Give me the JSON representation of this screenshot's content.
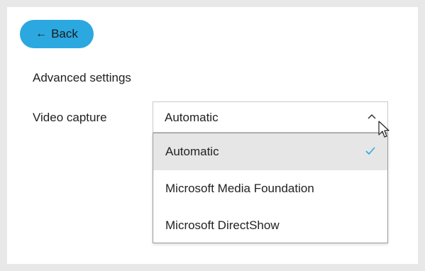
{
  "back_button": {
    "label": "Back",
    "icon": "arrow-left-icon"
  },
  "section": {
    "title": "Advanced settings"
  },
  "video_capture": {
    "label": "Video capture",
    "selected_value": "Automatic",
    "options": [
      {
        "label": "Automatic",
        "selected": true
      },
      {
        "label": "Microsoft Media Foundation",
        "selected": false
      },
      {
        "label": "Microsoft DirectShow",
        "selected": false
      }
    ]
  },
  "colors": {
    "accent": "#2ba8e0",
    "check": "#2ba8e0",
    "selected_option_bg": "#e6e6e6"
  }
}
